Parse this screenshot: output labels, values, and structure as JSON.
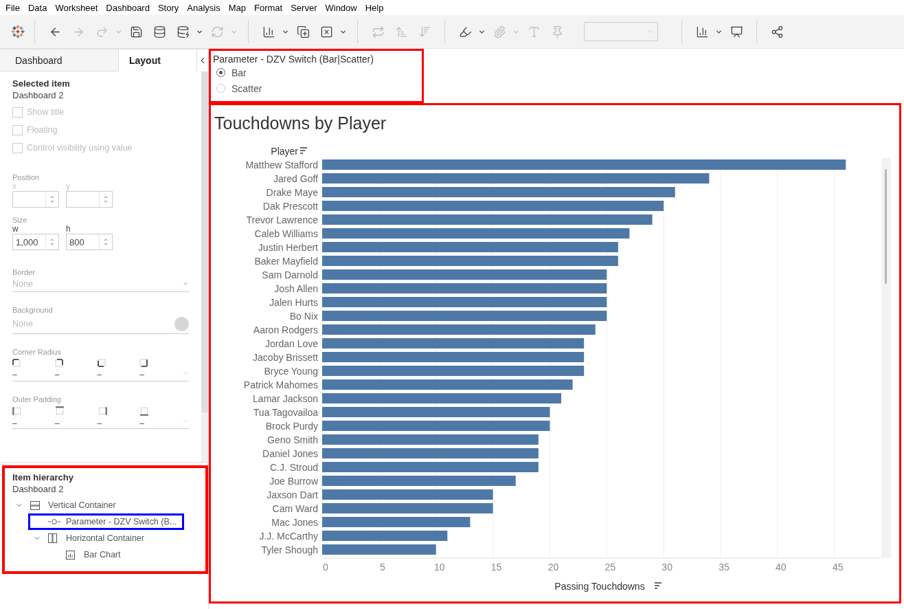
{
  "menu": [
    {
      "label": "File"
    },
    {
      "label": "Data"
    },
    {
      "label": "Worksheet"
    },
    {
      "label": "Dashboard"
    },
    {
      "label": "Story"
    },
    {
      "label": "Analysis"
    },
    {
      "label": "Map"
    },
    {
      "label": "Format"
    },
    {
      "label": "Server"
    },
    {
      "label": "Window"
    },
    {
      "label": "Help"
    }
  ],
  "side_panel": {
    "tabs": [
      {
        "label": "Dashboard",
        "selected": false
      },
      {
        "label": "Layout",
        "selected": true
      }
    ],
    "selected_item": {
      "heading": "Selected item",
      "name": "Dashboard 2"
    },
    "options": [
      {
        "label": "Show title",
        "checked": false,
        "disabled": true
      },
      {
        "label": "Floating",
        "checked": false,
        "disabled": true
      },
      {
        "label": "Control visibility using value",
        "checked": false,
        "disabled": true
      }
    ],
    "position": {
      "label": "Position",
      "fields": [
        {
          "label": "x"
        },
        {
          "label": "y"
        }
      ]
    },
    "size": {
      "label": "Size",
      "fields": [
        {
          "label": "w",
          "value": "1,000"
        },
        {
          "label": "h",
          "value": "800"
        }
      ]
    },
    "border": {
      "label": "Border",
      "value": "None"
    },
    "background": {
      "label": "Background",
      "value": "None"
    },
    "corner_radius": {
      "label": "Corner Radius",
      "values": [
        "–",
        "–",
        "–",
        "–"
      ]
    },
    "outer_padding": {
      "label": "Outer Padding",
      "values": [
        "–",
        "–",
        "–",
        "–"
      ]
    }
  },
  "item_hierarchy": {
    "heading": "Item hierarchy",
    "root": "Dashboard 2",
    "outlined": true,
    "items": [
      {
        "label": "Vertical Container",
        "kind": "vertical",
        "expanded": true,
        "outlined": false,
        "children": [
          {
            "label": "Parameter - DZV Switch (B...",
            "kind": "parameter",
            "outlined": true
          },
          {
            "label": "Horizontal Container",
            "kind": "horizontal",
            "expanded": true,
            "outlined": false,
            "children": [
              {
                "label": "Bar Chart",
                "kind": "chart",
                "outlined": false
              }
            ]
          }
        ]
      }
    ]
  },
  "parameter": {
    "title": "Parameter - DZV Switch (Bar|Scatter)",
    "outlined": true,
    "options": [
      {
        "label": "Bar",
        "selected": true
      },
      {
        "label": "Scatter",
        "selected": false
      }
    ]
  },
  "chart": {
    "outlined": true,
    "chart_data": {
      "type": "bar",
      "orientation": "horizontal",
      "title": "Touchdowns by Player",
      "ylabel": "Player",
      "xlabel": "Passing Touchdowns",
      "categories": [
        "Matthew Stafford",
        "Jared Goff",
        "Drake Maye",
        "Dak Prescott",
        "Trevor Lawrence",
        "Caleb Williams",
        "Justin Herbert",
        "Baker Mayfield",
        "Sam Darnold",
        "Josh Allen",
        "Jalen Hurts",
        "Bo Nix",
        "Aaron Rodgers",
        "Jordan Love",
        "Jacoby Brissett",
        "Bryce Young",
        "Patrick Mahomes",
        "Lamar Jackson",
        "Tua Tagovailoa",
        "Brock Purdy",
        "Geno Smith",
        "Daniel Jones",
        "C.J. Stroud",
        "Joe Burrow",
        "Jaxson Dart",
        "Cam Ward",
        "Mac Jones",
        "J.J. McCarthy",
        "Tyler Shough"
      ],
      "series": [
        {
          "color": "#4e79a7",
          "values": [
            46,
            34,
            31,
            30,
            29,
            27,
            26,
            26,
            25,
            25,
            25,
            25,
            24,
            23,
            23,
            23,
            22,
            21,
            20,
            20,
            19,
            19,
            19,
            17,
            15,
            15,
            13,
            11,
            10
          ]
        }
      ],
      "xlim": [
        0,
        49
      ],
      "grid": true,
      "xticks": [
        0,
        5,
        10,
        15,
        20,
        25,
        30,
        35,
        40,
        45
      ]
    }
  }
}
